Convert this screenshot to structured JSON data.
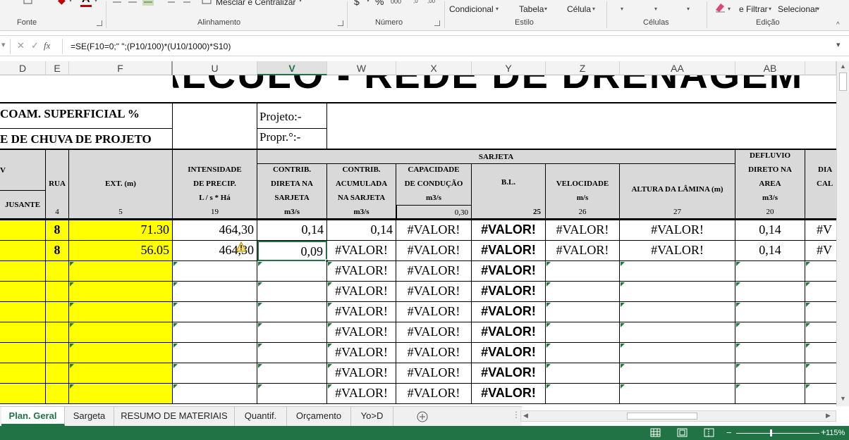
{
  "ribbon": {
    "merge_label": "Mesclar e Centralizar",
    "cond_format": "Condicional",
    "table_label": "Tabela",
    "cell_label": "Célula",
    "filter_label": "e Filtrar",
    "select_label": "Selecionar",
    "groups": {
      "fonte": "Fonte",
      "alinhamento": "Alinhamento",
      "numero": "Número",
      "estilo": "Estilo",
      "celulas": "Células",
      "edicao": "Edição"
    },
    "currency_symbol": "$",
    "percent_symbol": "%",
    "thousands_symbol": "000"
  },
  "formula_bar": {
    "fx": "fx",
    "formula": "=SE(F10=0;\" \";(P10/100)*(U10/1000)*S10)"
  },
  "columns": [
    "D",
    "E",
    "F",
    "U",
    "V",
    "W",
    "X",
    "Y",
    "Z",
    "AA",
    "AB"
  ],
  "sheet": {
    "title_fragment": "ÁLCULO - REDE DE DRENAGEM",
    "coef_label": "COAM. SUPERFICIAL %",
    "rain_label": "E DE CHUVA DE PROJETO",
    "projeto_label": "Projeto:-",
    "propr_label": "Propr.°:-",
    "sarjeta_group": "SARJETA",
    "hdr_v_partial": "V",
    "jusante": "JUSANTE",
    "rua": "RUA",
    "rua_num": "4",
    "ext": "EXT. (m)",
    "ext_num": "5",
    "intens_1": "INTENSIDADE",
    "intens_2": "DE PRECIP.",
    "intens_3": "L / s * Há",
    "intens_num": "19",
    "cdireta_1": "CONTRIB.",
    "cdireta_2": "DIRETA NA",
    "cdireta_3": "SARJETA",
    "cdireta_unit": "m3/s",
    "cacum_1": "CONTRIB.",
    "cacum_2": "ACUMULADA",
    "cacum_3": "NA SARJETA",
    "cacum_unit": "m3/s",
    "cap_1": "CAPACIDADE",
    "cap_2": "DE CONDUÇÃO",
    "cap_unit": "m3/s",
    "cap_val": "0,30",
    "bl": "B.L.",
    "bl_num": "25",
    "vel": "VELOCIDADE",
    "vel_unit": "m/s",
    "vel_num": "26",
    "alt": "ALTURA DA LÂMINA (m)",
    "alt_num": "27",
    "defl_1": "DEFLUVIO",
    "defl_2": "DIRETO NA",
    "defl_3": "AREA",
    "defl_unit": "m3/s",
    "defl_num": "20",
    "dia_1": "DIA",
    "dia_2": "CAL",
    "row1": {
      "rua": "8",
      "ext": "71.30",
      "intens": "464,30",
      "cdir": "0,14",
      "cacum": "0,14",
      "cap": "#VALOR!",
      "bl": "#VALOR!",
      "vel": "#VALOR!",
      "alt": "#VALOR!",
      "defl": "0,14",
      "dia": "#V"
    },
    "row2": {
      "rua": "8",
      "ext": "56.05",
      "intens": "464,30",
      "cdir": "0,09",
      "cacum": "#VALOR!",
      "cap": "#VALOR!",
      "bl": "#VALOR!",
      "vel": "#VALOR!",
      "alt": "#VALOR!",
      "defl": "0,14",
      "dia": "#V"
    },
    "empty_err": "#VALOR!"
  },
  "tabs": [
    {
      "label": "Plan. Geral",
      "active": true
    },
    {
      "label": "Sargeta"
    },
    {
      "label": "RESUMO DE MATERIAIS"
    },
    {
      "label": "Quantif."
    },
    {
      "label": "Orçamento"
    },
    {
      "label": "Yo>D"
    }
  ],
  "status": {
    "zoom": "115%"
  },
  "colors": {
    "excel_green": "#217346",
    "yellow_fill": "#ffff00",
    "header_gray": "#d9d9d9"
  }
}
